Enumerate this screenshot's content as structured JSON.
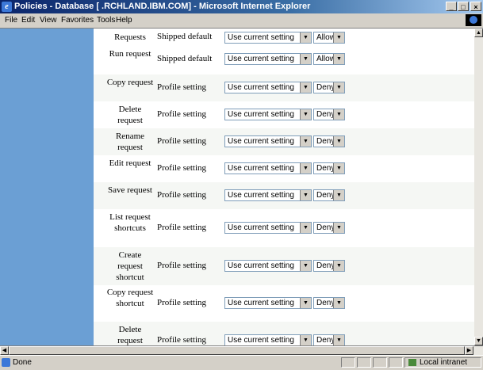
{
  "window": {
    "title": "Policies - Database [          .RCHLAND.IBM.COM] - Microsoft Internet Explorer",
    "minimize": "_",
    "maximize": "□",
    "close": "×"
  },
  "menu": [
    "File",
    "Edit",
    "View",
    "Favorites",
    "Tools",
    "Help"
  ],
  "rows": [
    {
      "label": "Requests",
      "source": "Shipped default",
      "setting": "Use current setting",
      "permission": "Allow"
    },
    {
      "label": "Run request",
      "source": "Shipped default",
      "setting": "Use current setting",
      "permission": "Allow"
    },
    {
      "label": "Copy request",
      "source": "Profile setting",
      "setting": "Use current setting",
      "permission": "Deny"
    },
    {
      "label": "Delete request",
      "source": "Profile setting",
      "setting": "Use current setting",
      "permission": "Deny"
    },
    {
      "label": "Rename request",
      "source": "Profile setting",
      "setting": "Use current setting",
      "permission": "Deny"
    },
    {
      "label": "Edit request",
      "source": "Profile setting",
      "setting": "Use current setting",
      "permission": "Deny"
    },
    {
      "label": "Save request",
      "source": "Profile setting",
      "setting": "Use current setting",
      "permission": "Deny"
    },
    {
      "label": "List request shortcuts",
      "source": "Profile setting",
      "setting": "Use current setting",
      "permission": "Deny"
    },
    {
      "label": "Create request shortcut",
      "source": "Profile setting",
      "setting": "Use current setting",
      "permission": "Deny"
    },
    {
      "label": "Copy request shortcut",
      "source": "Profile setting",
      "setting": "Use current setting",
      "permission": "Deny"
    },
    {
      "label": "Delete request",
      "source": "Profile setting",
      "setting": "Use current setting",
      "permission": "Deny"
    }
  ],
  "status": {
    "text": "Done",
    "zone": "Local intranet"
  }
}
